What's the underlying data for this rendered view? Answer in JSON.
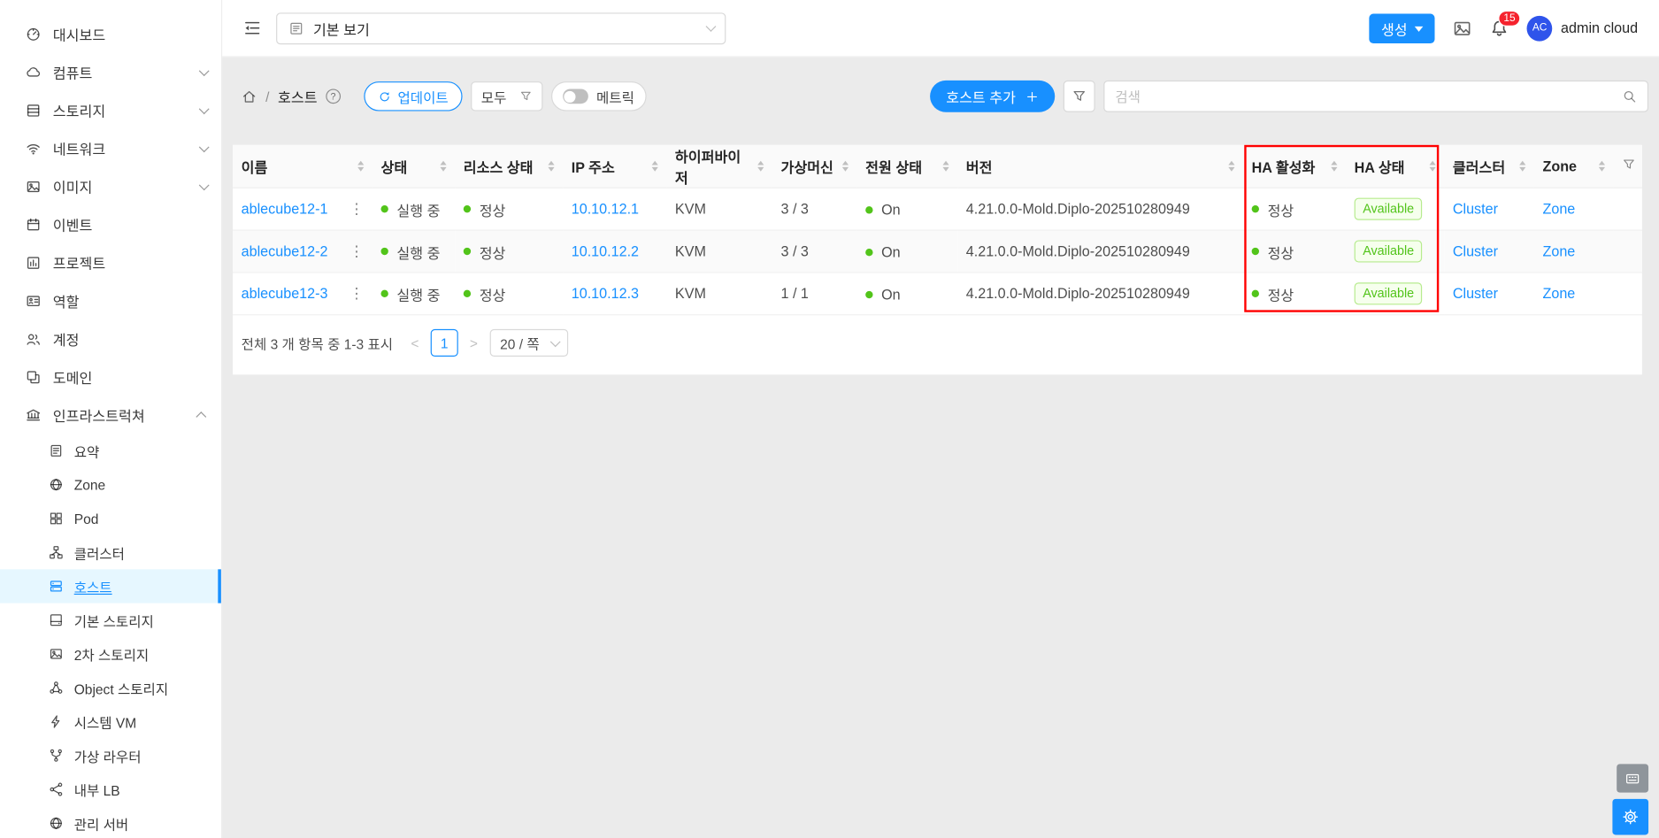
{
  "colors": {
    "primary": "#1890ff",
    "success": "#52c41a",
    "badge_bg": "#f6ffed",
    "badge_border": "#b7eb8f",
    "notification": "#f5222d",
    "annotation_box": "#ff0000",
    "selected_menu_bg": "#e6f7ff"
  },
  "header": {
    "view_select_value": "기본 보기",
    "create_button": "생성",
    "notification_count": "15",
    "avatar_initials": "AC",
    "username": "admin cloud"
  },
  "toolbar": {
    "breadcrumb_separator": "/",
    "breadcrumb_current": "호스트",
    "help_glyph": "?",
    "update_button": "업데이트",
    "filter_select_value": "모두",
    "metric_toggle_label": "메트릭",
    "add_host_button": "호스트 추가",
    "search_placeholder": "검색"
  },
  "sidebar": {
    "items": [
      {
        "label": "대시보드",
        "icon": "dashboard-icon"
      },
      {
        "label": "컴퓨트",
        "icon": "cloud-icon",
        "chevron": "down"
      },
      {
        "label": "스토리지",
        "icon": "storage-icon",
        "chevron": "down"
      },
      {
        "label": "네트워크",
        "icon": "network-icon",
        "chevron": "down"
      },
      {
        "label": "이미지",
        "icon": "image-icon",
        "chevron": "down"
      },
      {
        "label": "이벤트",
        "icon": "event-icon"
      },
      {
        "label": "프로젝트",
        "icon": "project-icon"
      },
      {
        "label": "역할",
        "icon": "role-icon"
      },
      {
        "label": "계정",
        "icon": "account-icon"
      },
      {
        "label": "도메인",
        "icon": "domain-icon"
      },
      {
        "label": "인프라스트럭쳐",
        "icon": "infrastructure-icon",
        "chevron": "up"
      },
      {
        "label": "요약",
        "icon": "summary-icon",
        "sub": true
      },
      {
        "label": "Zone",
        "icon": "zone-icon",
        "sub": true
      },
      {
        "label": "Pod",
        "icon": "pod-icon",
        "sub": true
      },
      {
        "label": "클러스터",
        "icon": "cluster-icon",
        "sub": true
      },
      {
        "label": "호스트",
        "icon": "host-icon",
        "sub": true,
        "selected": true
      },
      {
        "label": "기본 스토리지",
        "icon": "primary-storage-icon",
        "sub": true
      },
      {
        "label": "2차 스토리지",
        "icon": "secondary-storage-icon",
        "sub": true
      },
      {
        "label": "Object 스토리지",
        "icon": "object-storage-icon",
        "sub": true
      },
      {
        "label": "시스템 VM",
        "icon": "system-vm-icon",
        "sub": true
      },
      {
        "label": "가상 라우터",
        "icon": "virtual-router-icon",
        "sub": true
      },
      {
        "label": "내부 LB",
        "icon": "internal-lb-icon",
        "sub": true
      },
      {
        "label": "관리 서버",
        "icon": "management-server-icon",
        "sub": true
      }
    ]
  },
  "table": {
    "columns": [
      "이름",
      "상태",
      "리소스 상태",
      "IP 주소",
      "하이퍼바이저",
      "가상머신",
      "전원 상태",
      "버전",
      "HA 활성화",
      "HA 상태",
      "클러스터",
      "Zone"
    ],
    "rows": [
      {
        "name": "ablecube12-1",
        "status": "실행 중",
        "resource_state": "정상",
        "ip": "10.10.12.1",
        "hypervisor": "KVM",
        "vms": "3 / 3",
        "power": "On",
        "version": "4.21.0.0-Mold.Diplo-202510280949",
        "ha_enabled": "정상",
        "ha_state": "Available",
        "cluster": "Cluster",
        "zone": "Zone"
      },
      {
        "name": "ablecube12-2",
        "status": "실행 중",
        "resource_state": "정상",
        "ip": "10.10.12.2",
        "hypervisor": "KVM",
        "vms": "3 / 3",
        "power": "On",
        "version": "4.21.0.0-Mold.Diplo-202510280949",
        "ha_enabled": "정상",
        "ha_state": "Available",
        "cluster": "Cluster",
        "zone": "Zone"
      },
      {
        "name": "ablecube12-3",
        "status": "실행 중",
        "resource_state": "정상",
        "ip": "10.10.12.3",
        "hypervisor": "KVM",
        "vms": "1 / 1",
        "power": "On",
        "version": "4.21.0.0-Mold.Diplo-202510280949",
        "ha_enabled": "정상",
        "ha_state": "Available",
        "cluster": "Cluster",
        "zone": "Zone"
      }
    ]
  },
  "pagination": {
    "summary": "전체 3 개 항목 중 1-3 표시",
    "prev_glyph": "<",
    "next_glyph": ">",
    "current_page": "1",
    "page_size": "20 / 쪽"
  }
}
